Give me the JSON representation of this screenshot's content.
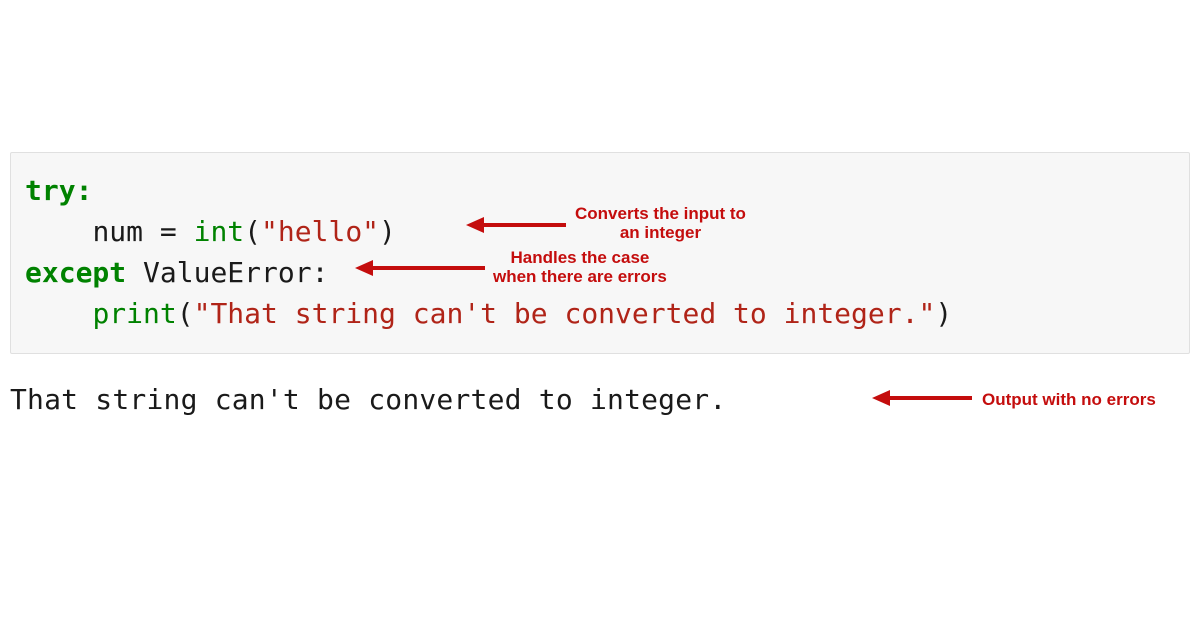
{
  "code": {
    "line1": {
      "try": "try:"
    },
    "line2": {
      "indent": "    num = ",
      "fn": "int",
      "paren_open": "(",
      "str": "\"hello\"",
      "paren_close": ")"
    },
    "line3": {
      "except": "except",
      "space": " ",
      "err": "ValueError:",
      "errname": "ValueError"
    },
    "line4": {
      "indent": "    ",
      "fn": "print",
      "paren_open": "(",
      "str": "\"That string can't be converted to integer.\"",
      "paren_close": ")"
    }
  },
  "output": "That string can't be converted to integer.",
  "annotations": {
    "convert": "Converts the input to\nan integer",
    "convert_l1": "Converts the input to",
    "convert_l2": "an integer",
    "handles": "Handles the case\nwhen there are errors",
    "handles_l1": "Handles the case",
    "handles_l2": "when there are errors",
    "outputnote": "Output with no errors"
  },
  "colors": {
    "annotation": "#c40d0d",
    "keyword": "#008200",
    "string": "#b02418",
    "codebg": "#f7f7f7"
  }
}
